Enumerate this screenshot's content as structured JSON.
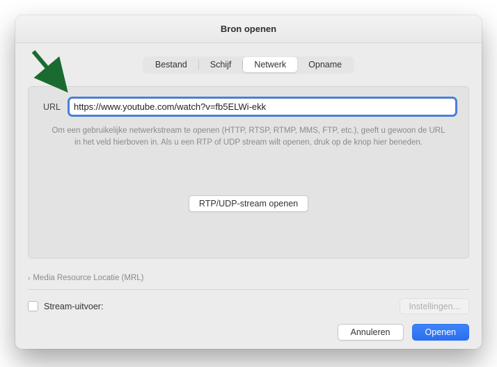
{
  "window": {
    "title": "Bron openen"
  },
  "tabs": {
    "items": [
      {
        "label": "Bestand"
      },
      {
        "label": "Schijf"
      },
      {
        "label": "Netwerk"
      },
      {
        "label": "Opname"
      }
    ],
    "active_index": 2
  },
  "url": {
    "label": "URL",
    "value": "https://www.youtube.com/watch?v=fb5ELWi-ekk"
  },
  "help_text": "Om een gebruikelijke netwerkstream te openen (HTTP, RTSP, RTMP, MMS, FTP, etc.), geeft u gewoon de URL in het veld hierboven in. Als u een RTP of UDP stream wilt openen, druk op de knop hier beneden.",
  "rtp_button": "RTP/UDP-stream openen",
  "disclosure": {
    "label": "Media Resource Locatie (MRL)"
  },
  "stream_output": {
    "label": "Stream-uitvoer:",
    "settings_label": "Instellingen...",
    "checked": false
  },
  "footer": {
    "cancel": "Annuleren",
    "open": "Openen"
  },
  "colors": {
    "accent": "#2b6ff0",
    "arrow": "#1a6b2f"
  }
}
